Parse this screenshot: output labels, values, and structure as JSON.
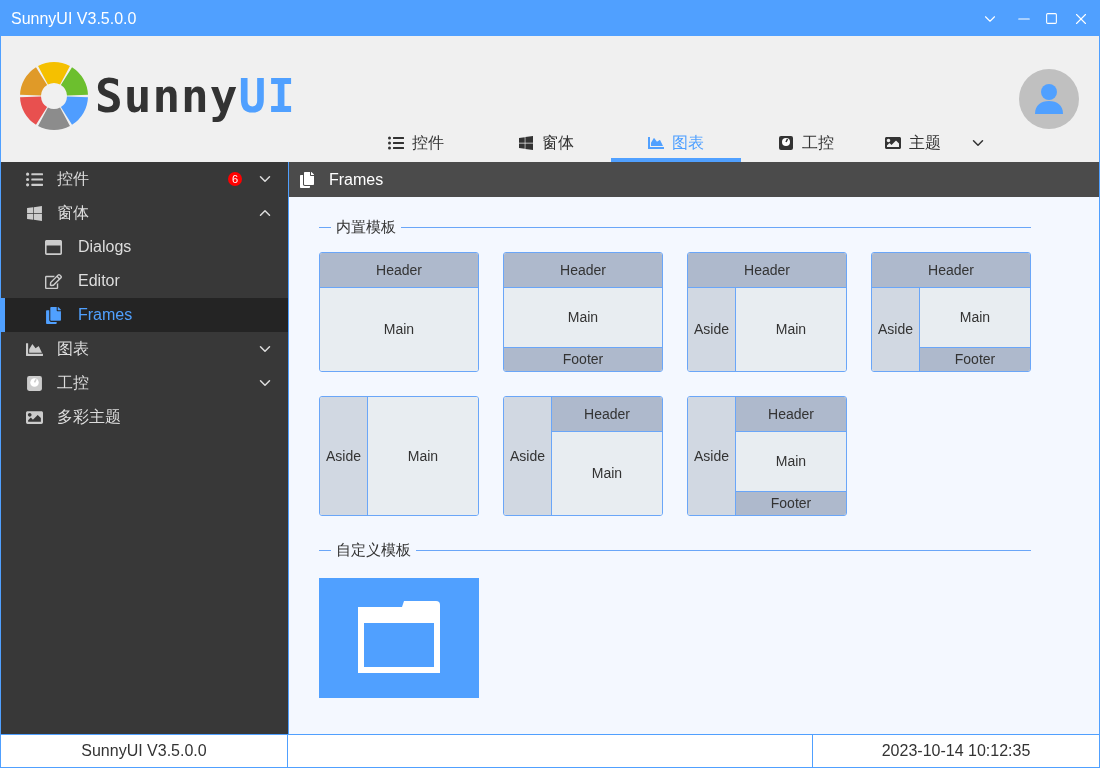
{
  "window": {
    "title": "SunnyUI V3.5.0.0"
  },
  "logo": {
    "word": "Sunny",
    "accent": "UI"
  },
  "top_tabs": [
    {
      "label": "控件",
      "kind": "list",
      "selected": false
    },
    {
      "label": "窗体",
      "kind": "windows",
      "selected": false
    },
    {
      "label": "图表",
      "kind": "chart",
      "selected": true
    },
    {
      "label": "工控",
      "kind": "gauge",
      "selected": false
    },
    {
      "label": "主题",
      "kind": "image",
      "selected": false,
      "dropdown": true
    }
  ],
  "sidebar": {
    "items": [
      {
        "label": "控件",
        "kind": "list",
        "badge": "6",
        "expanded": false,
        "selected": false
      },
      {
        "label": "窗体",
        "kind": "windows",
        "expanded": true,
        "selected": false,
        "children": [
          {
            "label": "Dialogs",
            "kind": "dialog",
            "selected": false
          },
          {
            "label": "Editor",
            "kind": "edit",
            "selected": false
          },
          {
            "label": "Frames",
            "kind": "copy",
            "selected": true
          }
        ]
      },
      {
        "label": "图表",
        "kind": "chart",
        "expanded": false,
        "selected": false
      },
      {
        "label": "工控",
        "kind": "gauge",
        "expanded": false,
        "selected": false
      },
      {
        "label": "多彩主题",
        "kind": "image",
        "selected": false
      }
    ]
  },
  "page": {
    "title": "Frames",
    "builtin_section": {
      "title": "内置模板",
      "templates": [
        {
          "kind": "header-top",
          "header": "Header",
          "main": "Main"
        },
        {
          "kind": "header-top",
          "header": "Header",
          "main": "Main",
          "footer": "Footer"
        },
        {
          "kind": "header-top",
          "header": "Header",
          "aside": "Aside",
          "main": "Main"
        },
        {
          "kind": "header-top",
          "header": "Header",
          "aside": "Aside",
          "main": "Main",
          "footer": "Footer"
        },
        {
          "kind": "aside-left",
          "aside": "Aside",
          "main": "Main"
        },
        {
          "kind": "aside-left",
          "aside": "Aside",
          "header": "Header",
          "main": "Main"
        },
        {
          "kind": "aside-left",
          "aside": "Aside",
          "header": "Header",
          "main": "Main",
          "footer": "Footer"
        }
      ]
    },
    "custom_section": {
      "title": "自定义模板"
    }
  },
  "status_bar": {
    "version": "SunnyUI V3.5.0.0",
    "datetime": "2023-10-14 10:12:35"
  }
}
